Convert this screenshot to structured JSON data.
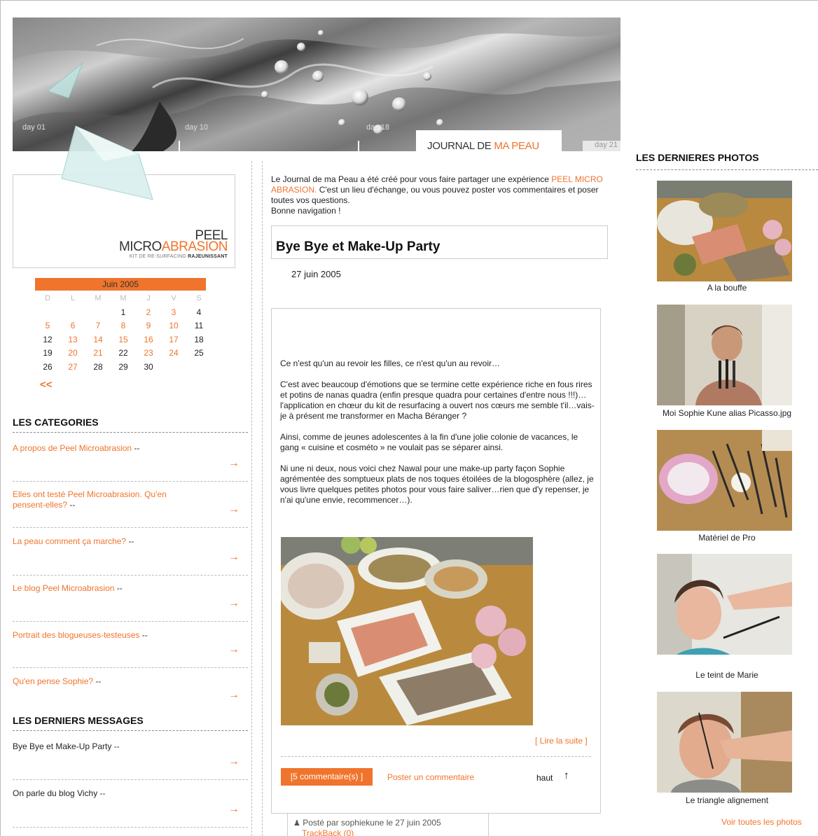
{
  "header": {
    "days": [
      "day 01",
      "day 10",
      "day 18",
      "day 21"
    ],
    "tab_title_prefix": "JOURNAL DE ",
    "tab_title_accent": "MA PEAU"
  },
  "logo": {
    "line1": "PEEL",
    "line2_a": "MICRO",
    "line2_b": "ABRASION",
    "tagline_a": "KIT DE RE-SURFACING ",
    "tagline_b": "RAJEUNISSANT"
  },
  "calendar": {
    "month": "Juin 2005",
    "day_headers": [
      "D",
      "L",
      "M",
      "M",
      "J",
      "V",
      "S"
    ],
    "weeks": [
      [
        "",
        "",
        "",
        "1",
        "2",
        "3",
        "4"
      ],
      [
        "5",
        "6",
        "7",
        "8",
        "9",
        "10",
        "11"
      ],
      [
        "12",
        "13",
        "14",
        "15",
        "16",
        "17",
        "18"
      ],
      [
        "19",
        "20",
        "21",
        "22",
        "23",
        "24",
        "25"
      ],
      [
        "26",
        "27",
        "28",
        "29",
        "30",
        "",
        ""
      ]
    ],
    "linked_days": [
      "2",
      "3",
      "5",
      "6",
      "7",
      "8",
      "9",
      "10",
      "13",
      "14",
      "15",
      "16",
      "17",
      "20",
      "21",
      "23",
      "24",
      "27"
    ],
    "prev": "<<"
  },
  "categories": {
    "title": "LES CATEGORIES",
    "items": [
      {
        "label": "A propos de Peel Microabrasion",
        "suffix": "--"
      },
      {
        "label": "Elles ont testé Peel Microabrasion. Qu'en pensent-elles?",
        "suffix": "--"
      },
      {
        "label": "La peau comment ça marche?",
        "suffix": "--"
      },
      {
        "label": "Le blog Peel Microabrasion",
        "suffix": "--"
      },
      {
        "label": "Portrait des blogueuses-testeuses",
        "suffix": "--"
      },
      {
        "label": "Qu'en pense Sophie?",
        "suffix": "--"
      }
    ]
  },
  "messages": {
    "title": "LES DERNIERS MESSAGES",
    "items": [
      {
        "label": "Bye Bye et Make-Up Party",
        "suffix": "--"
      },
      {
        "label": "On parle du blog Vichy",
        "suffix": "--"
      }
    ]
  },
  "intro": {
    "text_a": "Le Journal de ma Peau a été créé pour vous faire partager une expérience ",
    "link": "PEEL MICRO ABRASION.",
    "text_b": " C'est un lieu d'échange, ou vous pouvez poster vos commentaires et poser toutes vos questions.",
    "text_c": "Bonne navigation !"
  },
  "post": {
    "title": "Bye Bye et Make-Up Party",
    "date": "27 juin 2005",
    "paragraphs": [
      "Ce n'est qu'un au revoir les filles, ce n'est qu'un au revoir…",
      "C'est avec beaucoup d'émotions que se termine cette expérience riche en fous rires et potins de nanas quadra (enfin presque quadra pour certaines d'entre nous !!!)…l'application en chœur du kit de resurfacing a ouvert nos cœurs me semble t'il…vais-je à présent me transformer en Macha Béranger ?",
      "Ainsi, comme de jeunes adolescentes à la fin d'une jolie colonie de vacances, le gang « cuisine et cosméto » ne voulait pas se séparer ainsi.",
      "Ni une ni deux, nous voici chez Nawal pour une make-up party façon Sophie agrémentée des somptueux plats de nos toques étoilées de la blogosphère (allez, je vous livre quelques petites photos pour vous faire saliver…rien que d'y repenser, je n'ai qu'une envie, recommencer…)."
    ],
    "read_more": "[ Lire la suite ]",
    "comments": "[5 commentaire(s) ]",
    "post_comment": "Poster un commentaire",
    "top": "haut",
    "posted_by": "Posté par sophiekune le 27 juin 2005",
    "trackback": "TrackBack (0)"
  },
  "photos": {
    "title": "LES DERNIERES PHOTOS",
    "items": [
      {
        "caption": "A la bouffe"
      },
      {
        "caption": "Moi Sophie Kune alias Picasso.jpg"
      },
      {
        "caption": "Matériel de Pro"
      },
      {
        "caption": "Le teint de Marie"
      },
      {
        "caption": "Le triangle alignement"
      }
    ],
    "see_all": "Voir toutes les photos"
  },
  "colors": {
    "accent": "#f0742c",
    "text": "#222222",
    "border": "#cccccc"
  }
}
